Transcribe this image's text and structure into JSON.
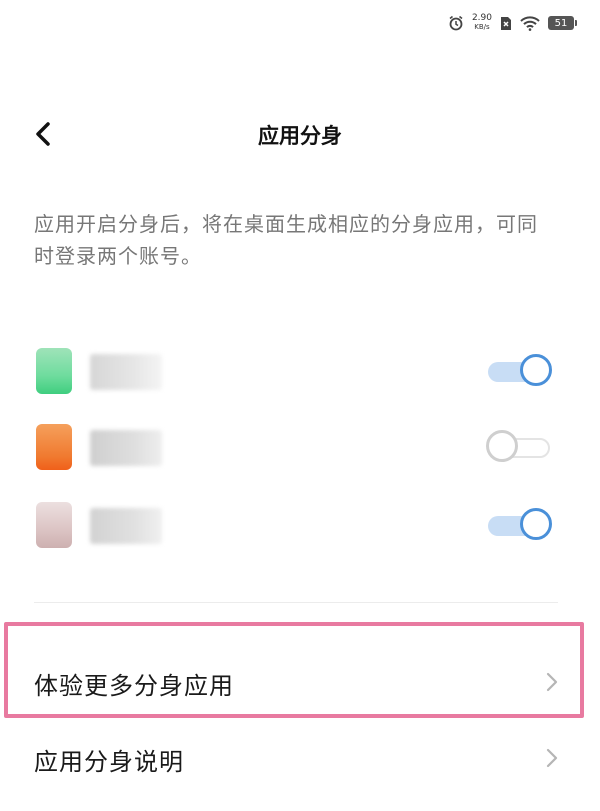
{
  "status_bar": {
    "alarm_icon": "alarm-clock-icon",
    "speed_value": "2.90",
    "speed_unit": "KB/s",
    "sim_icon": "no-sim-icon",
    "wifi_icon": "wifi-icon",
    "battery_level": "51"
  },
  "header": {
    "back_icon": "chevron-left-icon",
    "title": "应用分身"
  },
  "description": "应用开启分身后，将在桌面生成相应的分身应用，可同时登录两个账号。",
  "apps": [
    {
      "icon_color": "#4fd48a",
      "name_blurred": true,
      "clone_enabled": true
    },
    {
      "icon_color": "#f07a30",
      "name_blurred": true,
      "clone_enabled": false
    },
    {
      "icon_color": "#d9b8b8",
      "name_blurred": true,
      "clone_enabled": true
    }
  ],
  "menu": [
    {
      "label": "体验更多分身应用",
      "icon": "chevron-right-icon",
      "highlighted": true
    },
    {
      "label": "应用分身说明",
      "icon": "chevron-right-icon",
      "highlighted": false
    }
  ],
  "colors": {
    "toggle_on": "#4a90d9",
    "toggle_on_track": "#c8ddf5",
    "toggle_off": "#cfcfcf",
    "highlight_border": "#e87aa0",
    "description_text": "#777777"
  }
}
